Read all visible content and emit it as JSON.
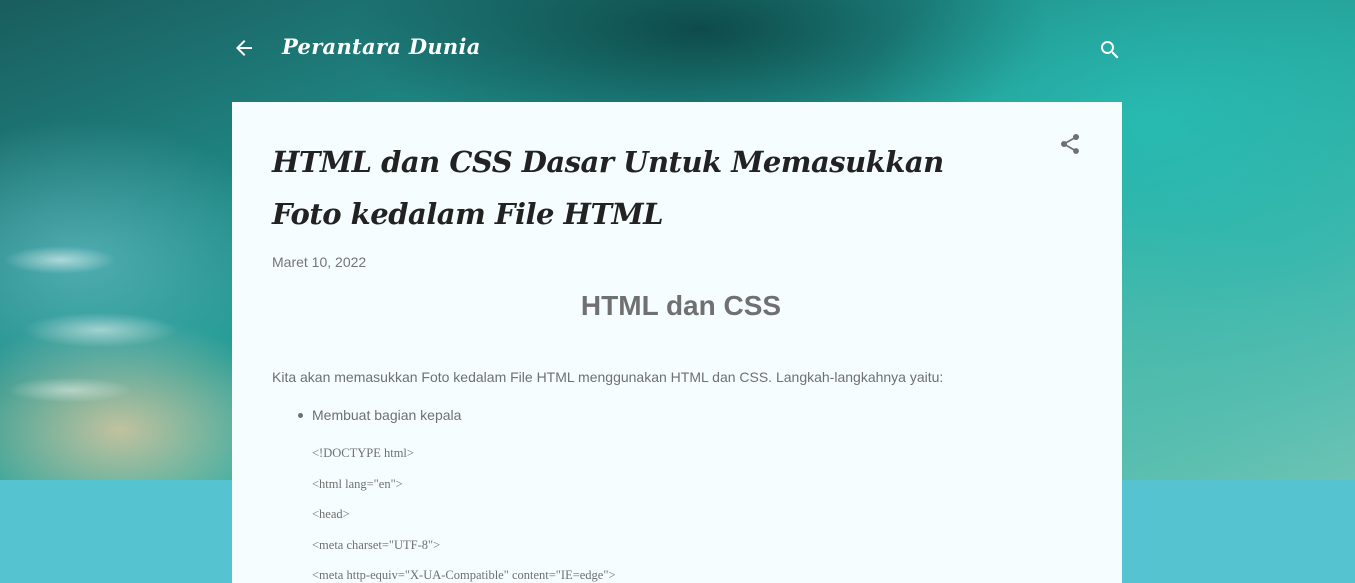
{
  "header": {
    "blog_title": "Perantara Dunia",
    "back_icon": "arrow-back-icon",
    "search_icon": "search-icon"
  },
  "post": {
    "title": "HTML dan CSS Dasar Untuk Memasukkan Foto kedalam File HTML",
    "date": "Maret 10, 2022",
    "share_icon": "share-icon",
    "section_heading": "HTML dan CSS",
    "intro": "Kita akan memasukkan Foto kedalam File HTML menggunakan HTML dan CSS. Langkah-langkahnya yaitu:",
    "bullets": [
      "Membuat bagian kepala"
    ],
    "code_lines": [
      "<!DOCTYPE html>",
      "<html lang=\"en\">",
      "<head>",
      "<meta charset=\"UTF-8\">",
      "<meta http-equiv=\"X-UA-Compatible\" content=\"IE=edge\">"
    ]
  },
  "colors": {
    "page_background": "#56c4d0",
    "post_background": "#f5fdfe",
    "text_muted": "#707070"
  }
}
